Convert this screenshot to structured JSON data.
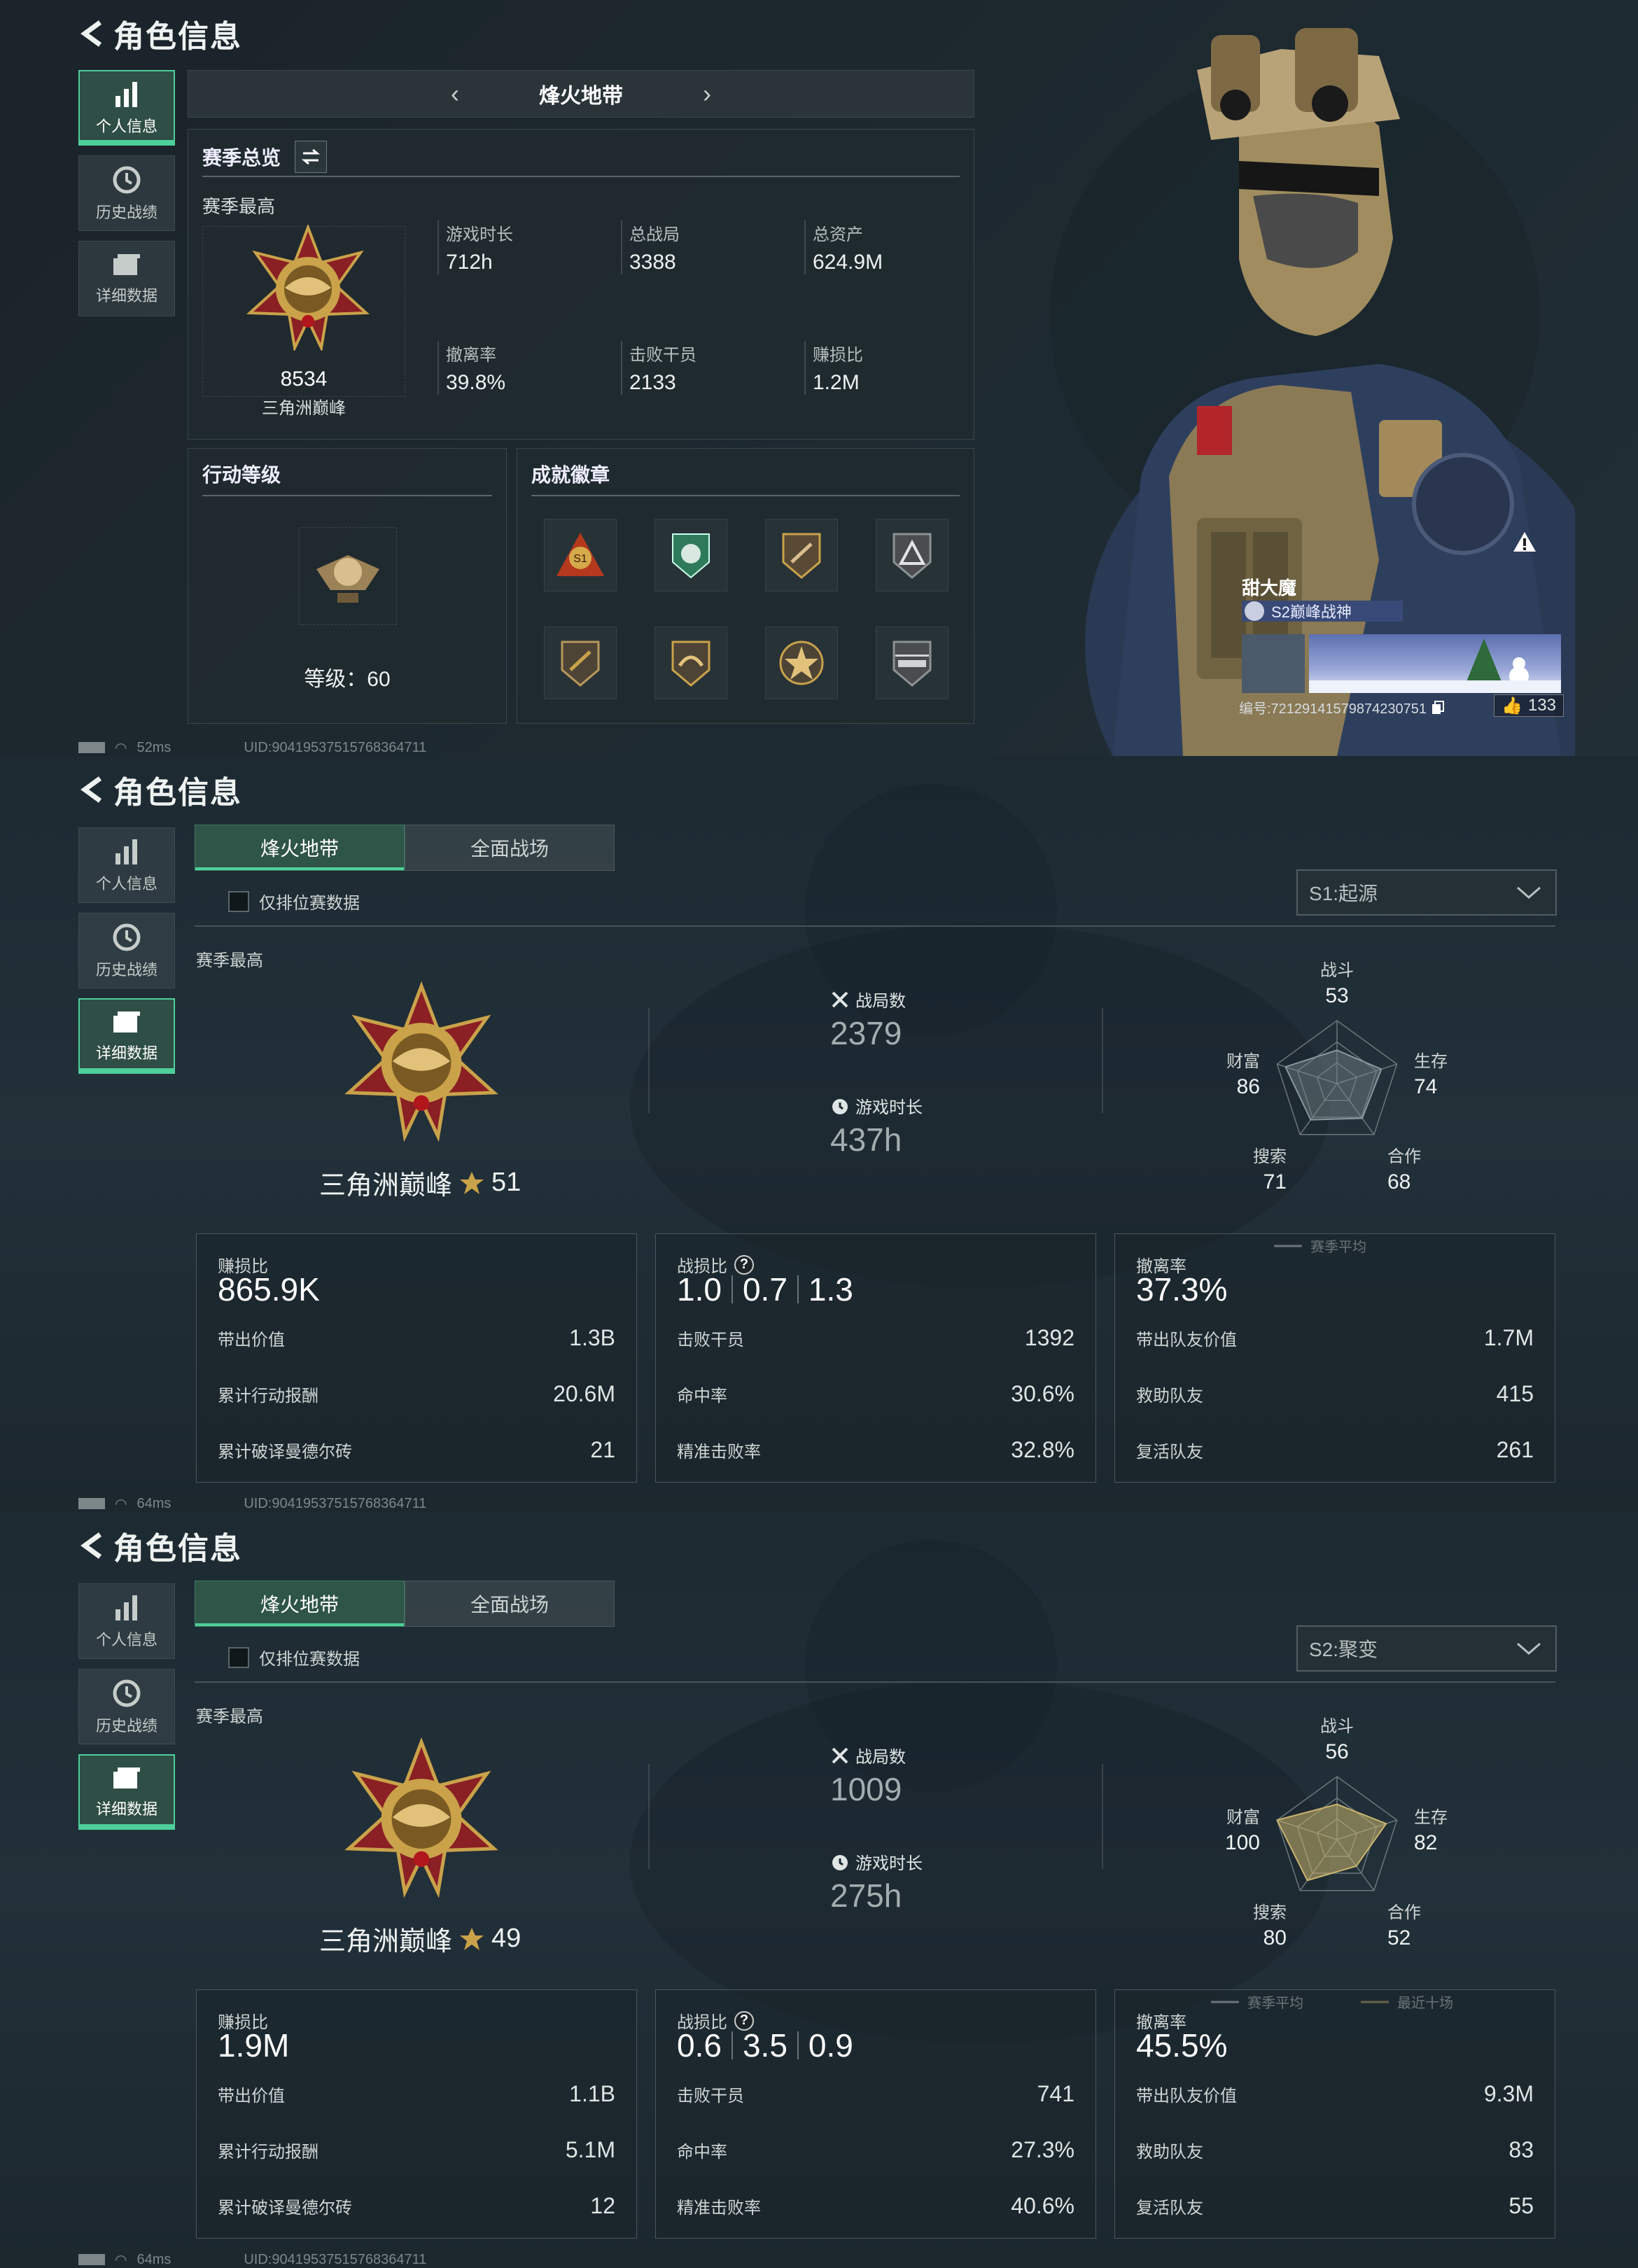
{
  "common": {
    "title": "角色信息",
    "nav": [
      {
        "label": "个人信息"
      },
      {
        "label": "历史战绩"
      },
      {
        "label": "详细数据"
      }
    ],
    "uid": "UID:9041953751576836471 1"
  },
  "panel1": {
    "map_name": "烽火地带",
    "overview_title": "赛季总览",
    "season_high_label": "赛季最高",
    "rank_score": "8534",
    "rank_name": "三角洲巅峰",
    "stats": [
      {
        "label": "游戏时长",
        "value": "712h"
      },
      {
        "label": "总战局",
        "value": "3388"
      },
      {
        "label": "总资产",
        "value": "624.9M"
      },
      {
        "label": "撤离率",
        "value": "39.8%"
      },
      {
        "label": "击败干员",
        "value": "2133"
      },
      {
        "label": "赚损比",
        "value": "1.2M"
      }
    ],
    "level_title": "行动等级",
    "level_label": "等级：60",
    "achievements_title": "成就徽章",
    "player_name": "甜大魔",
    "player_title": "S2巅峰战神",
    "player_id": "编号:72129141579874230751",
    "likes": "133",
    "ping": "52ms",
    "uid": "UID:90419537515768364711"
  },
  "panel2": {
    "tabs": [
      "烽火地带",
      "全面战场"
    ],
    "checkbox_label": "仅排位赛数据",
    "season": "S1:起源",
    "season_high_label": "赛季最高",
    "rank_name": "三角洲巅峰",
    "rank_stars": "51",
    "matches_label": "战局数",
    "matches": "2379",
    "playtime_label": "游戏时长",
    "playtime": "437h",
    "radar": {
      "labels": [
        "战斗",
        "生存",
        "合作",
        "搜索",
        "财富"
      ],
      "values": [
        53,
        74,
        68,
        71,
        86
      ],
      "legend": [
        "赛季平均"
      ]
    },
    "cards": [
      {
        "head_label": "赚损比",
        "head_values": [
          "865.9K"
        ],
        "rows": [
          {
            "label": "带出价值",
            "value": "1.3B"
          },
          {
            "label": "累计行动报酬",
            "value": "20.6M"
          },
          {
            "label": "累计破译曼德尔砖",
            "value": "21"
          }
        ]
      },
      {
        "head_label": "战损比",
        "head_values": [
          "1.0",
          "0.7",
          "1.3"
        ],
        "rows": [
          {
            "label": "击败干员",
            "value": "1392"
          },
          {
            "label": "命中率",
            "value": "30.6%"
          },
          {
            "label": "精准击败率",
            "value": "32.8%"
          }
        ]
      },
      {
        "head_label": "撤离率",
        "head_values": [
          "37.3%"
        ],
        "rows": [
          {
            "label": "带出队友价值",
            "value": "1.7M"
          },
          {
            "label": "救助队友",
            "value": "415"
          },
          {
            "label": "复活队友",
            "value": "261"
          }
        ]
      }
    ],
    "ping": "64ms",
    "uid": "UID:90419537515768364711"
  },
  "panel3": {
    "tabs": [
      "烽火地带",
      "全面战场"
    ],
    "checkbox_label": "仅排位赛数据",
    "season": "S2:聚变",
    "season_high_label": "赛季最高",
    "rank_name": "三角洲巅峰",
    "rank_stars": "49",
    "matches_label": "战局数",
    "matches": "1009",
    "playtime_label": "游戏时长",
    "playtime": "275h",
    "radar": {
      "labels": [
        "战斗",
        "生存",
        "合作",
        "搜索",
        "财富"
      ],
      "values": [
        56,
        82,
        52,
        80,
        100
      ],
      "legend": [
        "赛季平均",
        "最近十场"
      ]
    },
    "cards": [
      {
        "head_label": "赚损比",
        "head_values": [
          "1.9M"
        ],
        "rows": [
          {
            "label": "带出价值",
            "value": "1.1B"
          },
          {
            "label": "累计行动报酬",
            "value": "5.1M"
          },
          {
            "label": "累计破译曼德尔砖",
            "value": "12"
          }
        ]
      },
      {
        "head_label": "战损比",
        "head_values": [
          "0.6",
          "3.5",
          "0.9"
        ],
        "rows": [
          {
            "label": "击败干员",
            "value": "741"
          },
          {
            "label": "命中率",
            "value": "27.3%"
          },
          {
            "label": "精准击败率",
            "value": "40.6%"
          }
        ]
      },
      {
        "head_label": "撤离率",
        "head_values": [
          "45.5%"
        ],
        "rows": [
          {
            "label": "带出队友价值",
            "value": "9.3M"
          },
          {
            "label": "救助队友",
            "value": "83"
          },
          {
            "label": "复活队友",
            "value": "55"
          }
        ]
      }
    ],
    "ping": "64ms",
    "uid": "UID:90419537515768364711"
  },
  "colors": {
    "accent": "#4ecf9a",
    "gold": "#c9a24a",
    "medal_red": "#8a1f24"
  }
}
